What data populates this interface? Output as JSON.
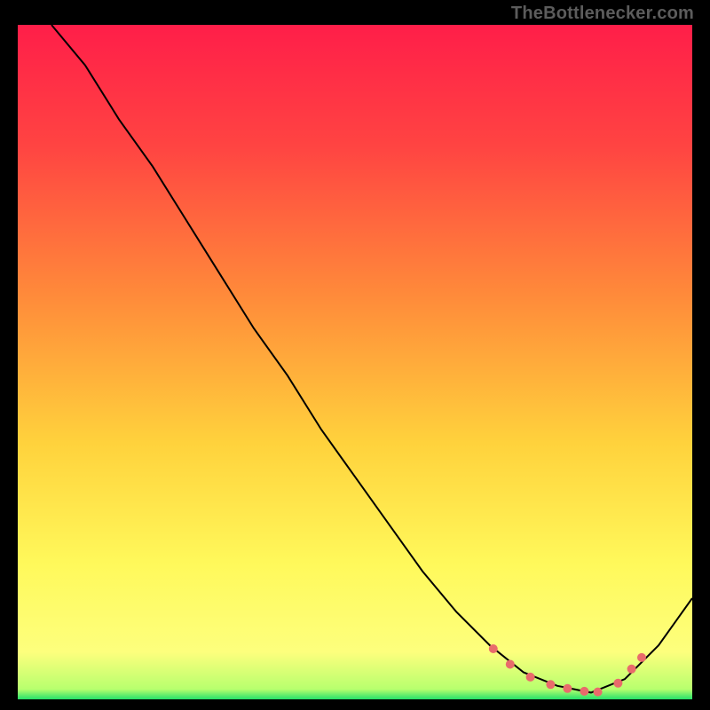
{
  "watermark": "TheBottlenecker.com",
  "chart_data": {
    "type": "line",
    "title": "",
    "xlabel": "",
    "ylabel": "",
    "xlim": [
      0,
      100
    ],
    "ylim": [
      0,
      100
    ],
    "grid": false,
    "series": [
      {
        "name": "curve",
        "color": "#000000",
        "x": [
          5,
          10,
          15,
          20,
          25,
          30,
          35,
          40,
          45,
          50,
          55,
          60,
          65,
          70,
          75,
          80,
          85,
          90,
          95,
          100
        ],
        "y": [
          100,
          94,
          86,
          79,
          71,
          63,
          55,
          48,
          40,
          33,
          26,
          19,
          13,
          8,
          4,
          2,
          1,
          3,
          8,
          15
        ]
      }
    ],
    "markers": {
      "name": "highlight-points",
      "color": "#e96b6b",
      "x": [
        70.5,
        73,
        76,
        79,
        81.5,
        84,
        86,
        89,
        91,
        92.5
      ],
      "y": [
        7.5,
        5.2,
        3.3,
        2.2,
        1.6,
        1.2,
        1.1,
        2.4,
        4.5,
        6.2
      ]
    },
    "gradient_stops": [
      {
        "offset": 0.0,
        "color": "#ff1e49"
      },
      {
        "offset": 0.18,
        "color": "#ff4442"
      },
      {
        "offset": 0.4,
        "color": "#ff8a3a"
      },
      {
        "offset": 0.62,
        "color": "#ffd23c"
      },
      {
        "offset": 0.8,
        "color": "#fff95b"
      },
      {
        "offset": 0.93,
        "color": "#fdff7d"
      },
      {
        "offset": 0.985,
        "color": "#b7ff6e"
      },
      {
        "offset": 1.0,
        "color": "#25e06a"
      }
    ]
  }
}
